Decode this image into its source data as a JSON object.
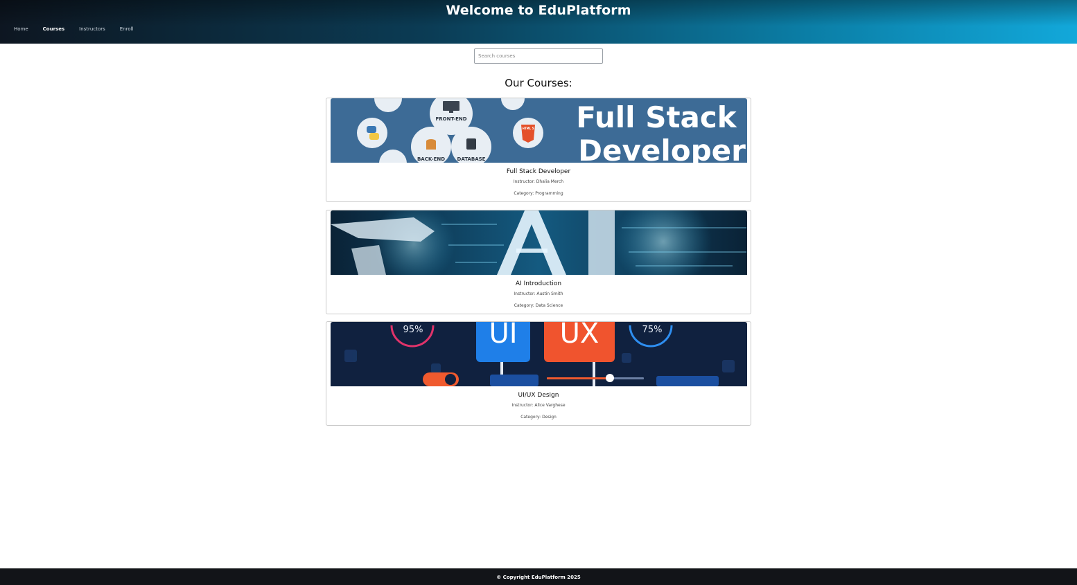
{
  "header": {
    "title": "Welcome to EduPlatform",
    "nav": [
      {
        "label": "Home",
        "active": false
      },
      {
        "label": "Courses",
        "active": true
      },
      {
        "label": "Instructors",
        "active": false
      },
      {
        "label": "Enroll",
        "active": false
      }
    ]
  },
  "search": {
    "placeholder": "Search courses",
    "value": ""
  },
  "main": {
    "section_title": "Our Courses:",
    "courses": [
      {
        "title": "Full Stack Developer",
        "instructor": "Instructor: Dhalia Merch",
        "category": "Category: Programming",
        "banner": {
          "headline_1": "Full Stack",
          "headline_2": "Developer",
          "labels": [
            "FRONT-END",
            "BACK-END",
            "DATABASE",
            "HTML 5"
          ]
        }
      },
      {
        "title": "AI Introduction",
        "instructor": "Instructor: Austin Smith",
        "category": "Category: Data Science",
        "banner": {
          "headline_1": "AI",
          "headline_2": "",
          "labels": []
        }
      },
      {
        "title": "UI/UX Design",
        "instructor": "Instructor: Alice Varghese",
        "category": "Category: Design",
        "banner": {
          "headline_1": "UI",
          "headline_2": "UX",
          "labels": [
            "95%",
            "75%"
          ]
        }
      }
    ]
  },
  "footer": {
    "text": "© Copyright EduPlatform 2025"
  },
  "colors": {
    "header_dark": "#0d1621",
    "header_light": "#12a8da",
    "footer_bg": "#121418",
    "card_border": "#c9c9c9",
    "banner1_bg": "#3d6b96",
    "banner2_bg": "#0b2a44",
    "banner3_bg": "#10213f",
    "ui_tile": "#1f7fe8",
    "ux_tile": "#f0542e"
  }
}
